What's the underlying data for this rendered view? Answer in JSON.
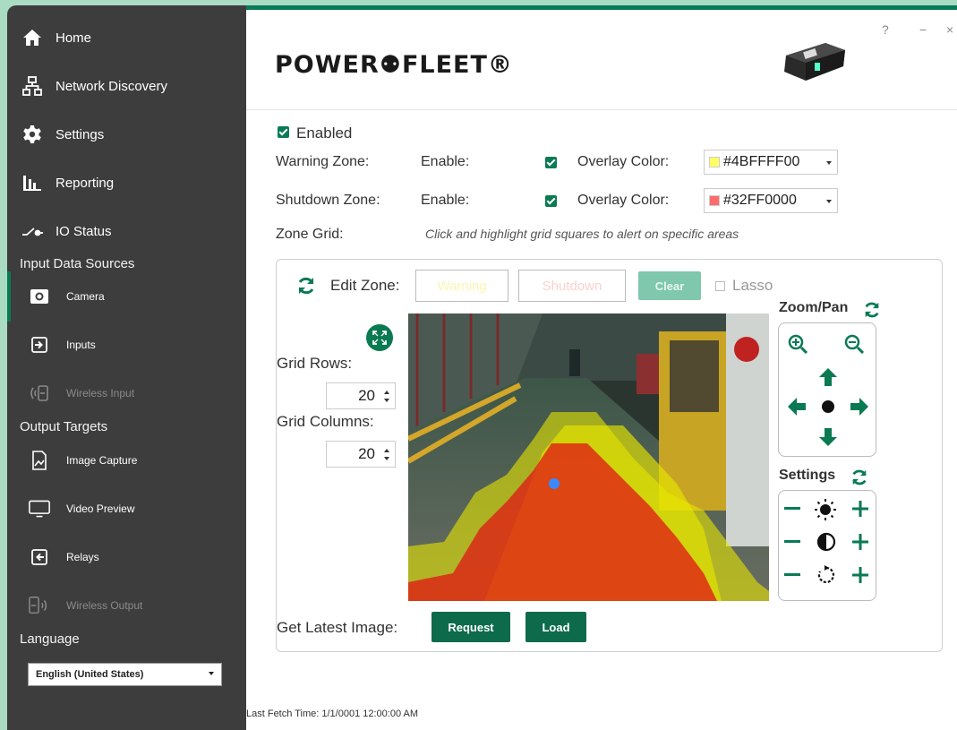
{
  "sidebar": {
    "nav": [
      {
        "label": "Home",
        "icon": "home-icon"
      },
      {
        "label": "Network Discovery",
        "icon": "network-icon"
      },
      {
        "label": "Settings",
        "icon": "gear-icon"
      },
      {
        "label": "Reporting",
        "icon": "bar-chart-icon"
      },
      {
        "label": "IO Status",
        "icon": "io-switch-icon"
      }
    ],
    "input_header": "Input Data Sources",
    "inputs": [
      {
        "label": "Camera",
        "icon": "camera-icon",
        "active": true
      },
      {
        "label": "Inputs",
        "icon": "input-arrow-icon"
      },
      {
        "label": "Wireless Input",
        "icon": "wireless-input-icon",
        "disabled": true
      }
    ],
    "output_header": "Output Targets",
    "outputs": [
      {
        "label": "Image Capture",
        "icon": "image-capture-icon"
      },
      {
        "label": "Video Preview",
        "icon": "monitor-icon"
      },
      {
        "label": "Relays",
        "icon": "relay-icon"
      },
      {
        "label": "Wireless Output",
        "icon": "wireless-output-icon",
        "disabled": true
      }
    ],
    "language_header": "Language",
    "language_value": "English (United States)"
  },
  "header": {
    "logo": "POWER⚉FLEET®",
    "help": "?",
    "minimize": "−",
    "close": "×"
  },
  "settings": {
    "enabled_label": "Enabled",
    "warning_zone": {
      "label": "Warning Zone:",
      "enable": "Enable:",
      "overlay": "Overlay Color:",
      "color": "#4BFFFF00",
      "swatch": "#ffff66"
    },
    "shutdown_zone": {
      "label": "Shutdown Zone:",
      "enable": "Enable:",
      "overlay": "Overlay Color:",
      "color": "#32FF0000",
      "swatch": "#ff6b6b"
    },
    "zone_grid_label": "Zone Grid:",
    "zone_grid_hint": "Click and highlight grid squares to alert on specific areas"
  },
  "panel": {
    "edit_zone": "Edit Zone:",
    "warning_btn": "Warning",
    "shutdown_btn": "Shutdown",
    "clear_btn": "Clear",
    "lasso": "Lasso",
    "grid_rows_label": "Grid Rows:",
    "grid_rows": "20",
    "grid_cols_label": "Grid Columns:",
    "grid_cols": "20",
    "zoom_pan": "Zoom/Pan",
    "settings_label": "Settings",
    "get_latest": "Get Latest Image:",
    "request": "Request",
    "load": "Load"
  },
  "footer": {
    "last_fetch": "Last Fetch Time: 1/1/0001 12:00:00 AM"
  },
  "colors": {
    "brand_green": "#0a7a53",
    "sidebar_bg": "#3d3d3d",
    "warning_overlay": "#e6e600",
    "shutdown_overlay": "#e01515"
  }
}
